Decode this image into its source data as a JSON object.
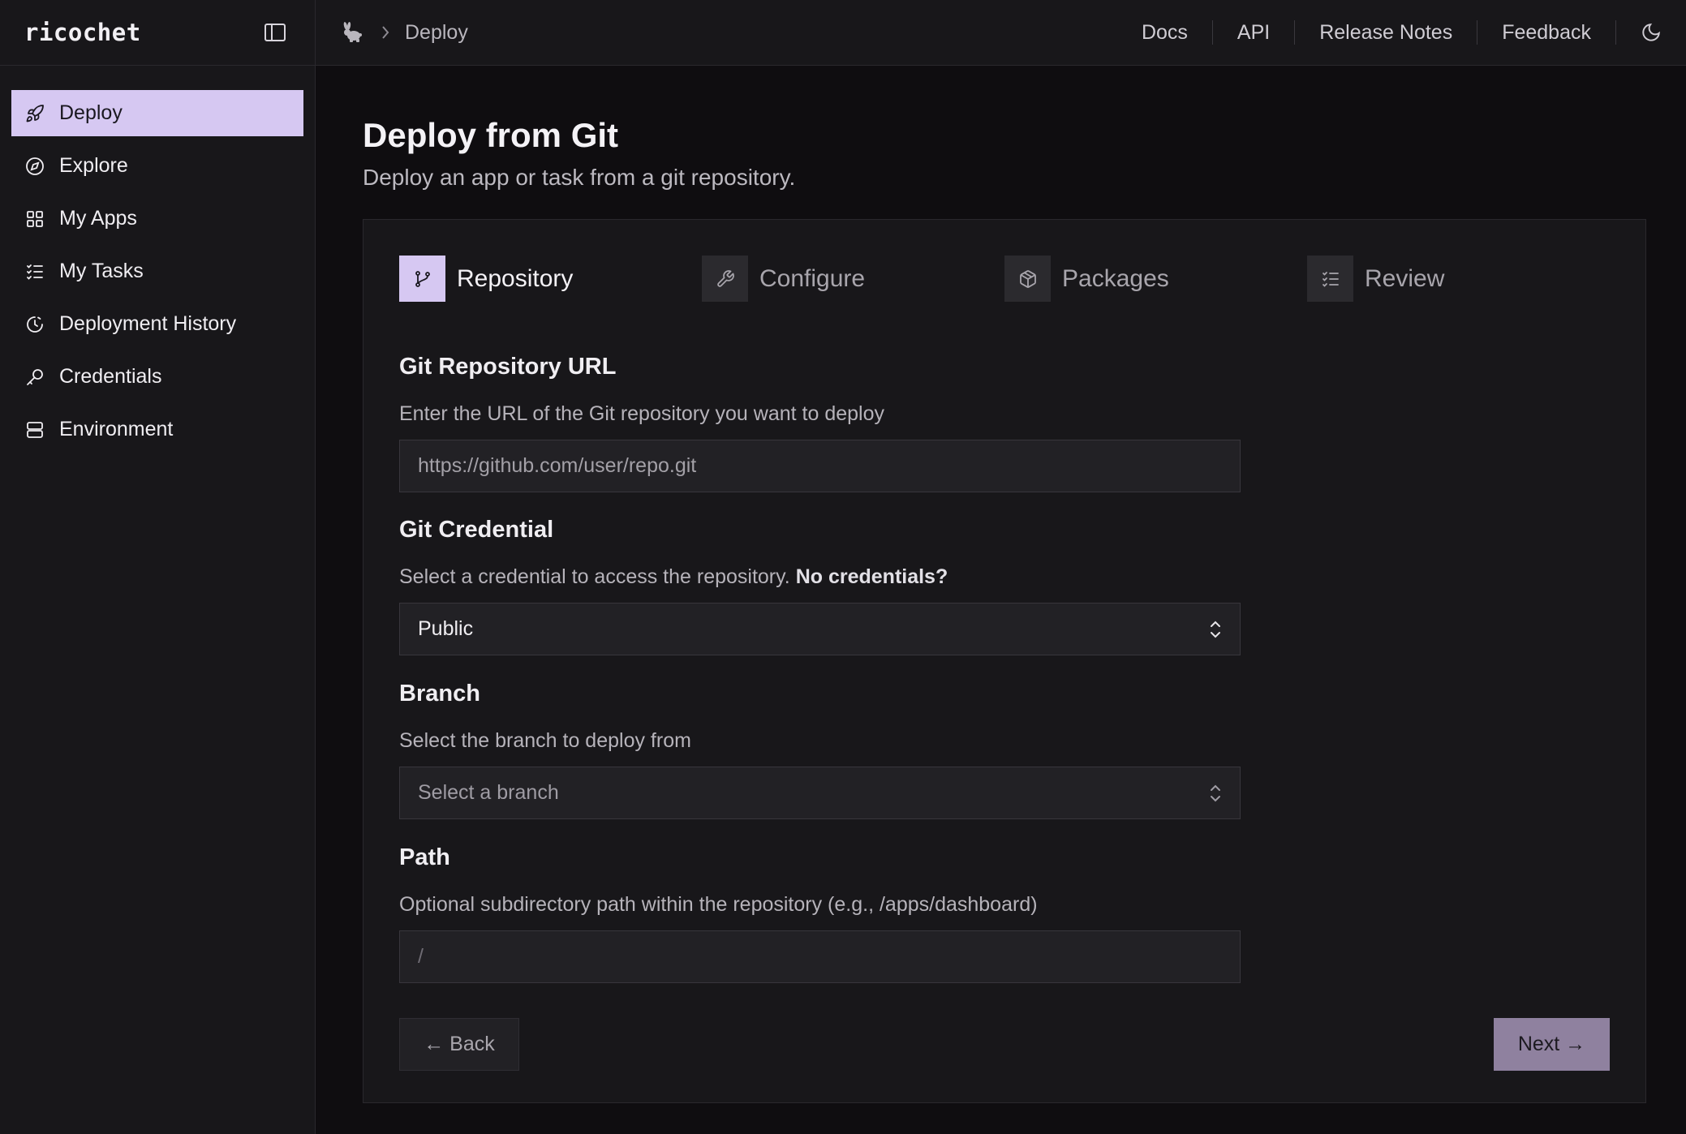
{
  "app": {
    "name": "ricochet"
  },
  "sidebar": {
    "items": [
      {
        "label": "Deploy",
        "icon": "rocket-icon",
        "active": true
      },
      {
        "label": "Explore",
        "icon": "compass-icon"
      },
      {
        "label": "My Apps",
        "icon": "grid-icon"
      },
      {
        "label": "My Tasks",
        "icon": "list-check-icon"
      },
      {
        "label": "Deployment History",
        "icon": "history-icon"
      },
      {
        "label": "Credentials",
        "icon": "key-icon"
      },
      {
        "label": "Environment",
        "icon": "server-icon"
      }
    ]
  },
  "topbar": {
    "breadcrumb": {
      "current": "Deploy"
    },
    "links": [
      "Docs",
      "API",
      "Release Notes",
      "Feedback"
    ]
  },
  "page": {
    "title": "Deploy from Git",
    "subtitle": "Deploy an app or task from a git repository."
  },
  "steps": [
    {
      "label": "Repository",
      "icon": "git-branch-icon",
      "active": true
    },
    {
      "label": "Configure",
      "icon": "wrench-icon"
    },
    {
      "label": "Packages",
      "icon": "package-icon"
    },
    {
      "label": "Review",
      "icon": "list-check-icon"
    }
  ],
  "form": {
    "repo_url": {
      "label": "Git Repository URL",
      "help": "Enter the URL of the Git repository you want to deploy",
      "placeholder": "https://github.com/user/repo.git"
    },
    "credential": {
      "label": "Git Credential",
      "help": "Select a credential to access the repository.",
      "help_link": "No credentials?",
      "value": "Public"
    },
    "branch": {
      "label": "Branch",
      "help": "Select the branch to deploy from",
      "placeholder": "Select a branch"
    },
    "path": {
      "label": "Path",
      "help": "Optional subdirectory path within the repository (e.g., /apps/dashboard)",
      "placeholder": "/"
    }
  },
  "actions": {
    "back": "← Back",
    "next": "Next →"
  },
  "colors": {
    "accent": "#d6c8f2",
    "next_button": "#8f819f",
    "background": "#0f0d10",
    "panel": "#18171a"
  }
}
